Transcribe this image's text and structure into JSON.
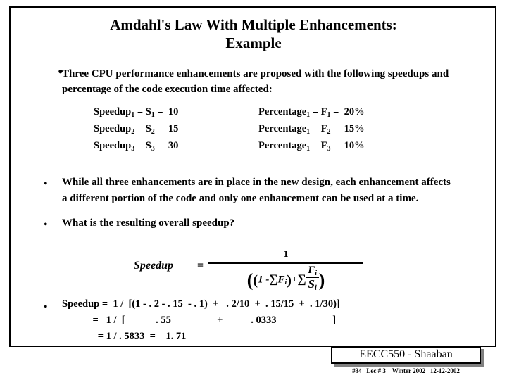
{
  "slide": {
    "title_line1": "Amdahl's Law With Multiple Enhancements:",
    "title_line2": "Example",
    "bullet1": "Three CPU performance enhancements are proposed with the following speedups and percentage of the code execution time affected:",
    "table": [
      {
        "speedup": "Speedup",
        "speedup_sub": "1",
        "speedup_rest": " = S",
        "speedup_sub2": "1",
        "speedup_val": " =  10",
        "pct": "Percentage",
        "pct_sub": "1",
        "pct_rest": " = F",
        "pct_sub2": "1",
        "pct_val": " =  20%"
      },
      {
        "speedup": "Speedup",
        "speedup_sub": "2",
        "speedup_rest": " = S",
        "speedup_sub2": "2",
        "speedup_val": " =  15",
        "pct": "Percentage",
        "pct_sub": "1",
        "pct_rest": " = F",
        "pct_sub2": "2",
        "pct_val": " =  15%"
      },
      {
        "speedup": "Speedup",
        "speedup_sub": "3",
        "speedup_rest": " = S",
        "speedup_sub2": "3",
        "speedup_val": " =  30",
        "pct": "Percentage",
        "pct_sub": "1",
        "pct_rest": " = F",
        "pct_sub2": "3",
        "pct_val": " =  10%"
      }
    ],
    "bullet2": "While all three enhancements are in place in the new design,  each enhancement affects a different portion of the code and only one enhancement can be used at a time.",
    "bullet3": "What is the resulting overall speedup?",
    "formula": {
      "label": "Speedup",
      "equals": "=",
      "numerator": "1",
      "denominator_open": "(",
      "denominator_inner_open": "(",
      "denominator_one_minus": "1 -",
      "denominator_sum1": "∑",
      "denominator_f": "F",
      "denominator_f_sub": "i",
      "denominator_inner_close": ")",
      "denominator_plus": "+",
      "denominator_sum2": "∑",
      "denominator_frac_num": "F",
      "denominator_frac_num_sub": "i",
      "denominator_frac_den": "S",
      "denominator_frac_den_sub": "i",
      "denominator_close": ")"
    },
    "bullet4_line1": "Speedup =  1 /  [(1 - . 2 - . 15  - . 1)  +   . 2/10  +  . 15/15  +  . 1/30)]",
    "bullet4_line2": "            =   1 /  [            . 55                  +           . 0333                      ]",
    "bullet4_line3": "              = 1 / . 5833  =    1. 71",
    "bullet_marker": "•"
  },
  "footer": {
    "title": "EECC550 - Shaaban",
    "meta": "#34   Lec # 3    Winter 2002   12-12-2002"
  }
}
